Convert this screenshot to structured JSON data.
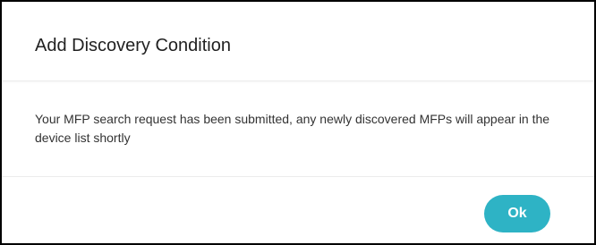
{
  "dialog": {
    "title": "Add Discovery Condition",
    "message": "Your MFP search request has been submitted, any newly discovered MFPs will appear in the device list shortly",
    "ok_label": "Ok"
  },
  "colors": {
    "accent": "#2eb3c5",
    "border": "#000000",
    "divider": "#ececec",
    "text": "#212121"
  }
}
